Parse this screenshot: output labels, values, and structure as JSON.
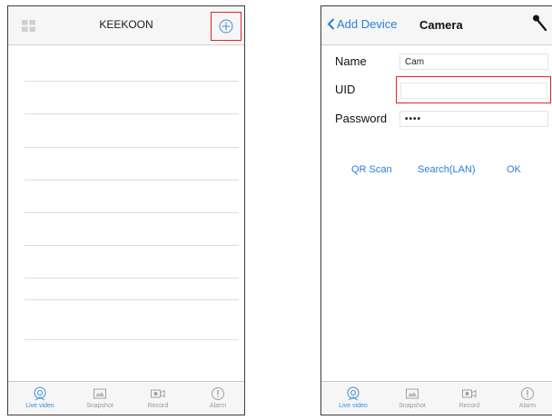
{
  "left_screen": {
    "title": "KEEKOON",
    "add_icon": "plus-circle-icon",
    "menu_icon": "grid-icon"
  },
  "right_screen": {
    "back_label": "Add Device",
    "title": "Camera",
    "settings_icon": "wrench-icon",
    "fields": {
      "name": {
        "label": "Name",
        "value": "Cam"
      },
      "uid": {
        "label": "UID",
        "value": ""
      },
      "password": {
        "label": "Password",
        "value": "••••"
      }
    },
    "actions": {
      "qr_scan": "QR Scan",
      "search_lan": "Search(LAN)",
      "ok": "OK"
    }
  },
  "tabbar": {
    "items": [
      {
        "label": "Live video",
        "icon": "live-video-icon",
        "active": true
      },
      {
        "label": "Snapshot",
        "icon": "snapshot-icon",
        "active": false
      },
      {
        "label": "Record",
        "icon": "record-icon",
        "active": false
      },
      {
        "label": "Alarm",
        "icon": "alarm-icon",
        "active": false
      }
    ]
  },
  "colors": {
    "accent_blue": "#2a7fd4",
    "highlight_red": "#e0242b",
    "inactive_gray": "#9a9a9a"
  }
}
